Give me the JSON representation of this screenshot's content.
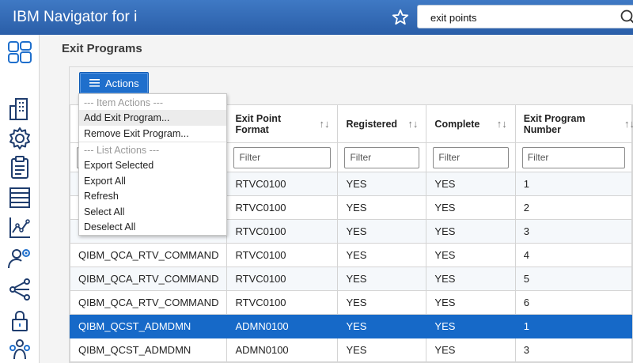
{
  "app": {
    "title": "IBM Navigator for i"
  },
  "search": {
    "value": "exit points"
  },
  "page": {
    "title": "Exit Programs"
  },
  "toolbar": {
    "actions_label": "Actions"
  },
  "menu": {
    "item_actions_header": "--- Item Actions ---",
    "add_exit_program": "Add Exit Program...",
    "remove_exit_program": "Remove Exit Program...",
    "list_actions_header": "--- List Actions ---",
    "export_selected": "Export Selected",
    "export_all": "Export All",
    "refresh": "Refresh",
    "select_all": "Select All",
    "deselect_all": "Deselect All"
  },
  "table": {
    "columns": [
      {
        "label": "",
        "sortable": false
      },
      {
        "label": "Exit Point Format",
        "sortable": true
      },
      {
        "label": "Registered",
        "sortable": true
      },
      {
        "label": "Complete",
        "sortable": true
      },
      {
        "label": "Exit Program Number",
        "sortable": true
      }
    ],
    "sort_glyph": "↑↓",
    "filter_placeholder": "Filter",
    "rows": [
      {
        "name": "",
        "format": "RTVC0100",
        "registered": "YES",
        "complete": "YES",
        "number": "1",
        "selected": false
      },
      {
        "name": "",
        "format": "RTVC0100",
        "registered": "YES",
        "complete": "YES",
        "number": "2",
        "selected": false
      },
      {
        "name": "",
        "format": "RTVC0100",
        "registered": "YES",
        "complete": "YES",
        "number": "3",
        "selected": false
      },
      {
        "name": "QIBM_QCA_RTV_COMMAND",
        "format": "RTVC0100",
        "registered": "YES",
        "complete": "YES",
        "number": "4",
        "selected": false
      },
      {
        "name": "QIBM_QCA_RTV_COMMAND",
        "format": "RTVC0100",
        "registered": "YES",
        "complete": "YES",
        "number": "5",
        "selected": false
      },
      {
        "name": "QIBM_QCA_RTV_COMMAND",
        "format": "RTVC0100",
        "registered": "YES",
        "complete": "YES",
        "number": "6",
        "selected": false
      },
      {
        "name": "QIBM_QCST_ADMDMN",
        "format": "ADMN0100",
        "registered": "YES",
        "complete": "YES",
        "number": "1",
        "selected": true
      },
      {
        "name": "QIBM_QCST_ADMDMN",
        "format": "ADMN0100",
        "registered": "YES",
        "complete": "YES",
        "number": "3",
        "selected": false
      }
    ]
  },
  "sidebar": {
    "icons": [
      "dashboard-icon",
      "building-icon",
      "gear-icon",
      "clipboard-icon",
      "database-icon",
      "chart-icon",
      "user-gear-icon",
      "network-icon",
      "lock-icon",
      "users-icon"
    ]
  },
  "colors": {
    "header_blue": "#2f68b4",
    "accent_blue": "#1f6fcc",
    "selected_row": "#1669c8"
  }
}
